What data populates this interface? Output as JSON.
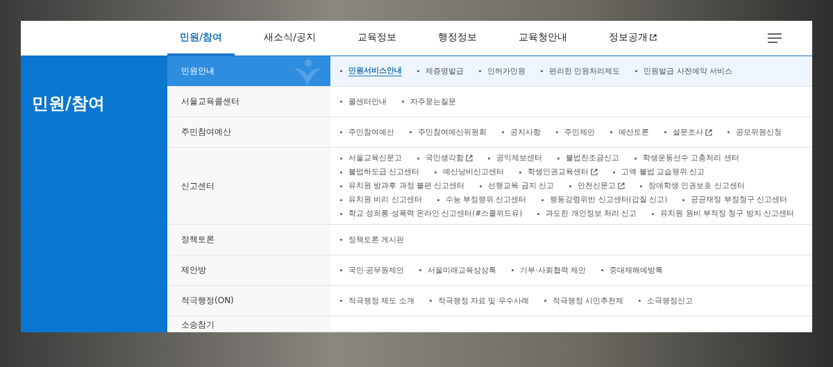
{
  "nav": {
    "tabs": [
      {
        "label": "민원/참여",
        "selected": true,
        "external": false
      },
      {
        "label": "새소식/공지",
        "selected": false,
        "external": false
      },
      {
        "label": "교육정보",
        "selected": false,
        "external": false
      },
      {
        "label": "행정정보",
        "selected": false,
        "external": false
      },
      {
        "label": "교육청안내",
        "selected": false,
        "external": false
      },
      {
        "label": "정보공개",
        "selected": false,
        "external": true
      }
    ]
  },
  "section_title": "민원/참여",
  "categories": [
    {
      "label": "민원안내",
      "selected": true,
      "links": [
        {
          "label": "민원서비스안내",
          "selected": true,
          "external": false
        },
        {
          "label": "제증명발급",
          "selected": false,
          "external": false
        },
        {
          "label": "인허가민원",
          "selected": false,
          "external": false
        },
        {
          "label": "편리한 민원처리제도",
          "selected": false,
          "external": false
        },
        {
          "label": "민원발급 사전예약 서비스",
          "selected": false,
          "external": false
        }
      ]
    },
    {
      "label": "서울교육콜센터",
      "selected": false,
      "links": [
        {
          "label": "콜센터안내",
          "selected": false,
          "external": false
        },
        {
          "label": "자주묻는질문",
          "selected": false,
          "external": false
        }
      ]
    },
    {
      "label": "주민참여예산",
      "selected": false,
      "links": [
        {
          "label": "주민참여예산",
          "selected": false,
          "external": false
        },
        {
          "label": "주민참여예산위원회",
          "selected": false,
          "external": false
        },
        {
          "label": "공지사항",
          "selected": false,
          "external": false
        },
        {
          "label": "주민제안",
          "selected": false,
          "external": false
        },
        {
          "label": "예산토론",
          "selected": false,
          "external": false
        },
        {
          "label": "설문조사",
          "selected": false,
          "external": true
        },
        {
          "label": "공모위원신청",
          "selected": false,
          "external": false
        }
      ]
    },
    {
      "label": "신고센터",
      "selected": false,
      "links": [
        {
          "label": "서울교육신문고",
          "selected": false,
          "external": false
        },
        {
          "label": "국민생각함",
          "selected": false,
          "external": true
        },
        {
          "label": "공익제보센터",
          "selected": false,
          "external": false
        },
        {
          "label": "불법찬조금신고",
          "selected": false,
          "external": false
        },
        {
          "label": "학생운동선수 고충처리 센터",
          "selected": false,
          "external": false
        },
        {
          "label": "불법하도급 신고센터",
          "selected": false,
          "external": false
        },
        {
          "label": "예산낭비신고센터",
          "selected": false,
          "external": false
        },
        {
          "label": "학생인권교육센터",
          "selected": false,
          "external": true
        },
        {
          "label": "고액 불법 교습행위 신고",
          "selected": false,
          "external": false
        },
        {
          "label": "유치원 방과후 과정 불편 신고센터",
          "selected": false,
          "external": false
        },
        {
          "label": "선행교육 금지 신고",
          "selected": false,
          "external": false
        },
        {
          "label": "안전신문고",
          "selected": false,
          "external": true
        },
        {
          "label": "장애학생 인권보호 신고센터",
          "selected": false,
          "external": false
        },
        {
          "label": "유치원 비리 신고센터",
          "selected": false,
          "external": false
        },
        {
          "label": "수능 부정행위 신고센터",
          "selected": false,
          "external": false
        },
        {
          "label": "행동강령위반 신고센터(갑질 신고)",
          "selected": false,
          "external": false
        },
        {
          "label": "공공재정 부정청구 신고센터",
          "selected": false,
          "external": false
        },
        {
          "label": "학교 성희롱·성폭력 온라인 신고센터(#스쿨위드유)",
          "selected": false,
          "external": false
        },
        {
          "label": "과도한 개인정보 처리 신고",
          "selected": false,
          "external": false
        },
        {
          "label": "유치원 원비 부적정 청구 방지 신고센터",
          "selected": false,
          "external": false
        }
      ]
    },
    {
      "label": "정책토론",
      "selected": false,
      "links": [
        {
          "label": "정책토론 게시판",
          "selected": false,
          "external": false
        }
      ]
    },
    {
      "label": "제안방",
      "selected": false,
      "links": [
        {
          "label": "국민·공무원제안",
          "selected": false,
          "external": false
        },
        {
          "label": "서울미래교육상상톡",
          "selected": false,
          "external": false
        },
        {
          "label": "기부·사회협력 제안",
          "selected": false,
          "external": false
        },
        {
          "label": "중대재해예방톡",
          "selected": false,
          "external": false
        }
      ]
    },
    {
      "label": "적극행정(ON)",
      "selected": false,
      "links": [
        {
          "label": "적극행정 제도 소개",
          "selected": false,
          "external": false
        },
        {
          "label": "적극행정 자료 및 우수사례",
          "selected": false,
          "external": false
        },
        {
          "label": "적극행정 시민추천제",
          "selected": false,
          "external": false
        },
        {
          "label": "소극행정신고",
          "selected": false,
          "external": false
        }
      ]
    },
    {
      "label": "소송참기",
      "selected": false
    }
  ]
}
